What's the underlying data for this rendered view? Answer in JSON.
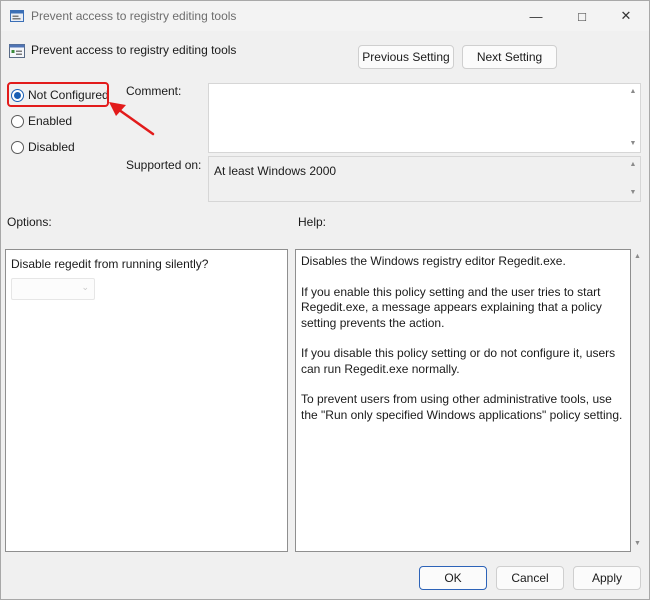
{
  "window": {
    "title": "Prevent access to registry editing tools",
    "minimize_glyph": "—",
    "maximize_glyph": "□",
    "close_glyph": "✕"
  },
  "header": {
    "title": "Prevent access to registry editing tools",
    "previous_label": "Previous Setting",
    "next_label": "Next Setting"
  },
  "state": {
    "options": [
      {
        "label": "Not Configured",
        "selected": true
      },
      {
        "label": "Enabled",
        "selected": false
      },
      {
        "label": "Disabled",
        "selected": false
      }
    ],
    "highlight_color": "#e21b1b"
  },
  "comment": {
    "label": "Comment:",
    "value": ""
  },
  "supported": {
    "label": "Supported on:",
    "value": "At least Windows 2000"
  },
  "options_section": {
    "label": "Options:",
    "setting_label": "Disable regedit from running silently?",
    "dropdown_value": ""
  },
  "help_section": {
    "label": "Help:",
    "paragraphs": [
      "Disables the Windows registry editor Regedit.exe.",
      "If you enable this policy setting and the user tries to start Regedit.exe, a message appears explaining that a policy setting prevents the action.",
      "If you disable this policy setting or do not configure it, users can run Regedit.exe normally.",
      "To prevent users from using other administrative tools, use the \"Run only specified Windows applications\" policy setting."
    ]
  },
  "footer": {
    "ok_label": "OK",
    "cancel_label": "Cancel",
    "apply_label": "Apply"
  },
  "colors": {
    "accent": "#1a5fb4",
    "ok_border": "#2d63b8"
  }
}
